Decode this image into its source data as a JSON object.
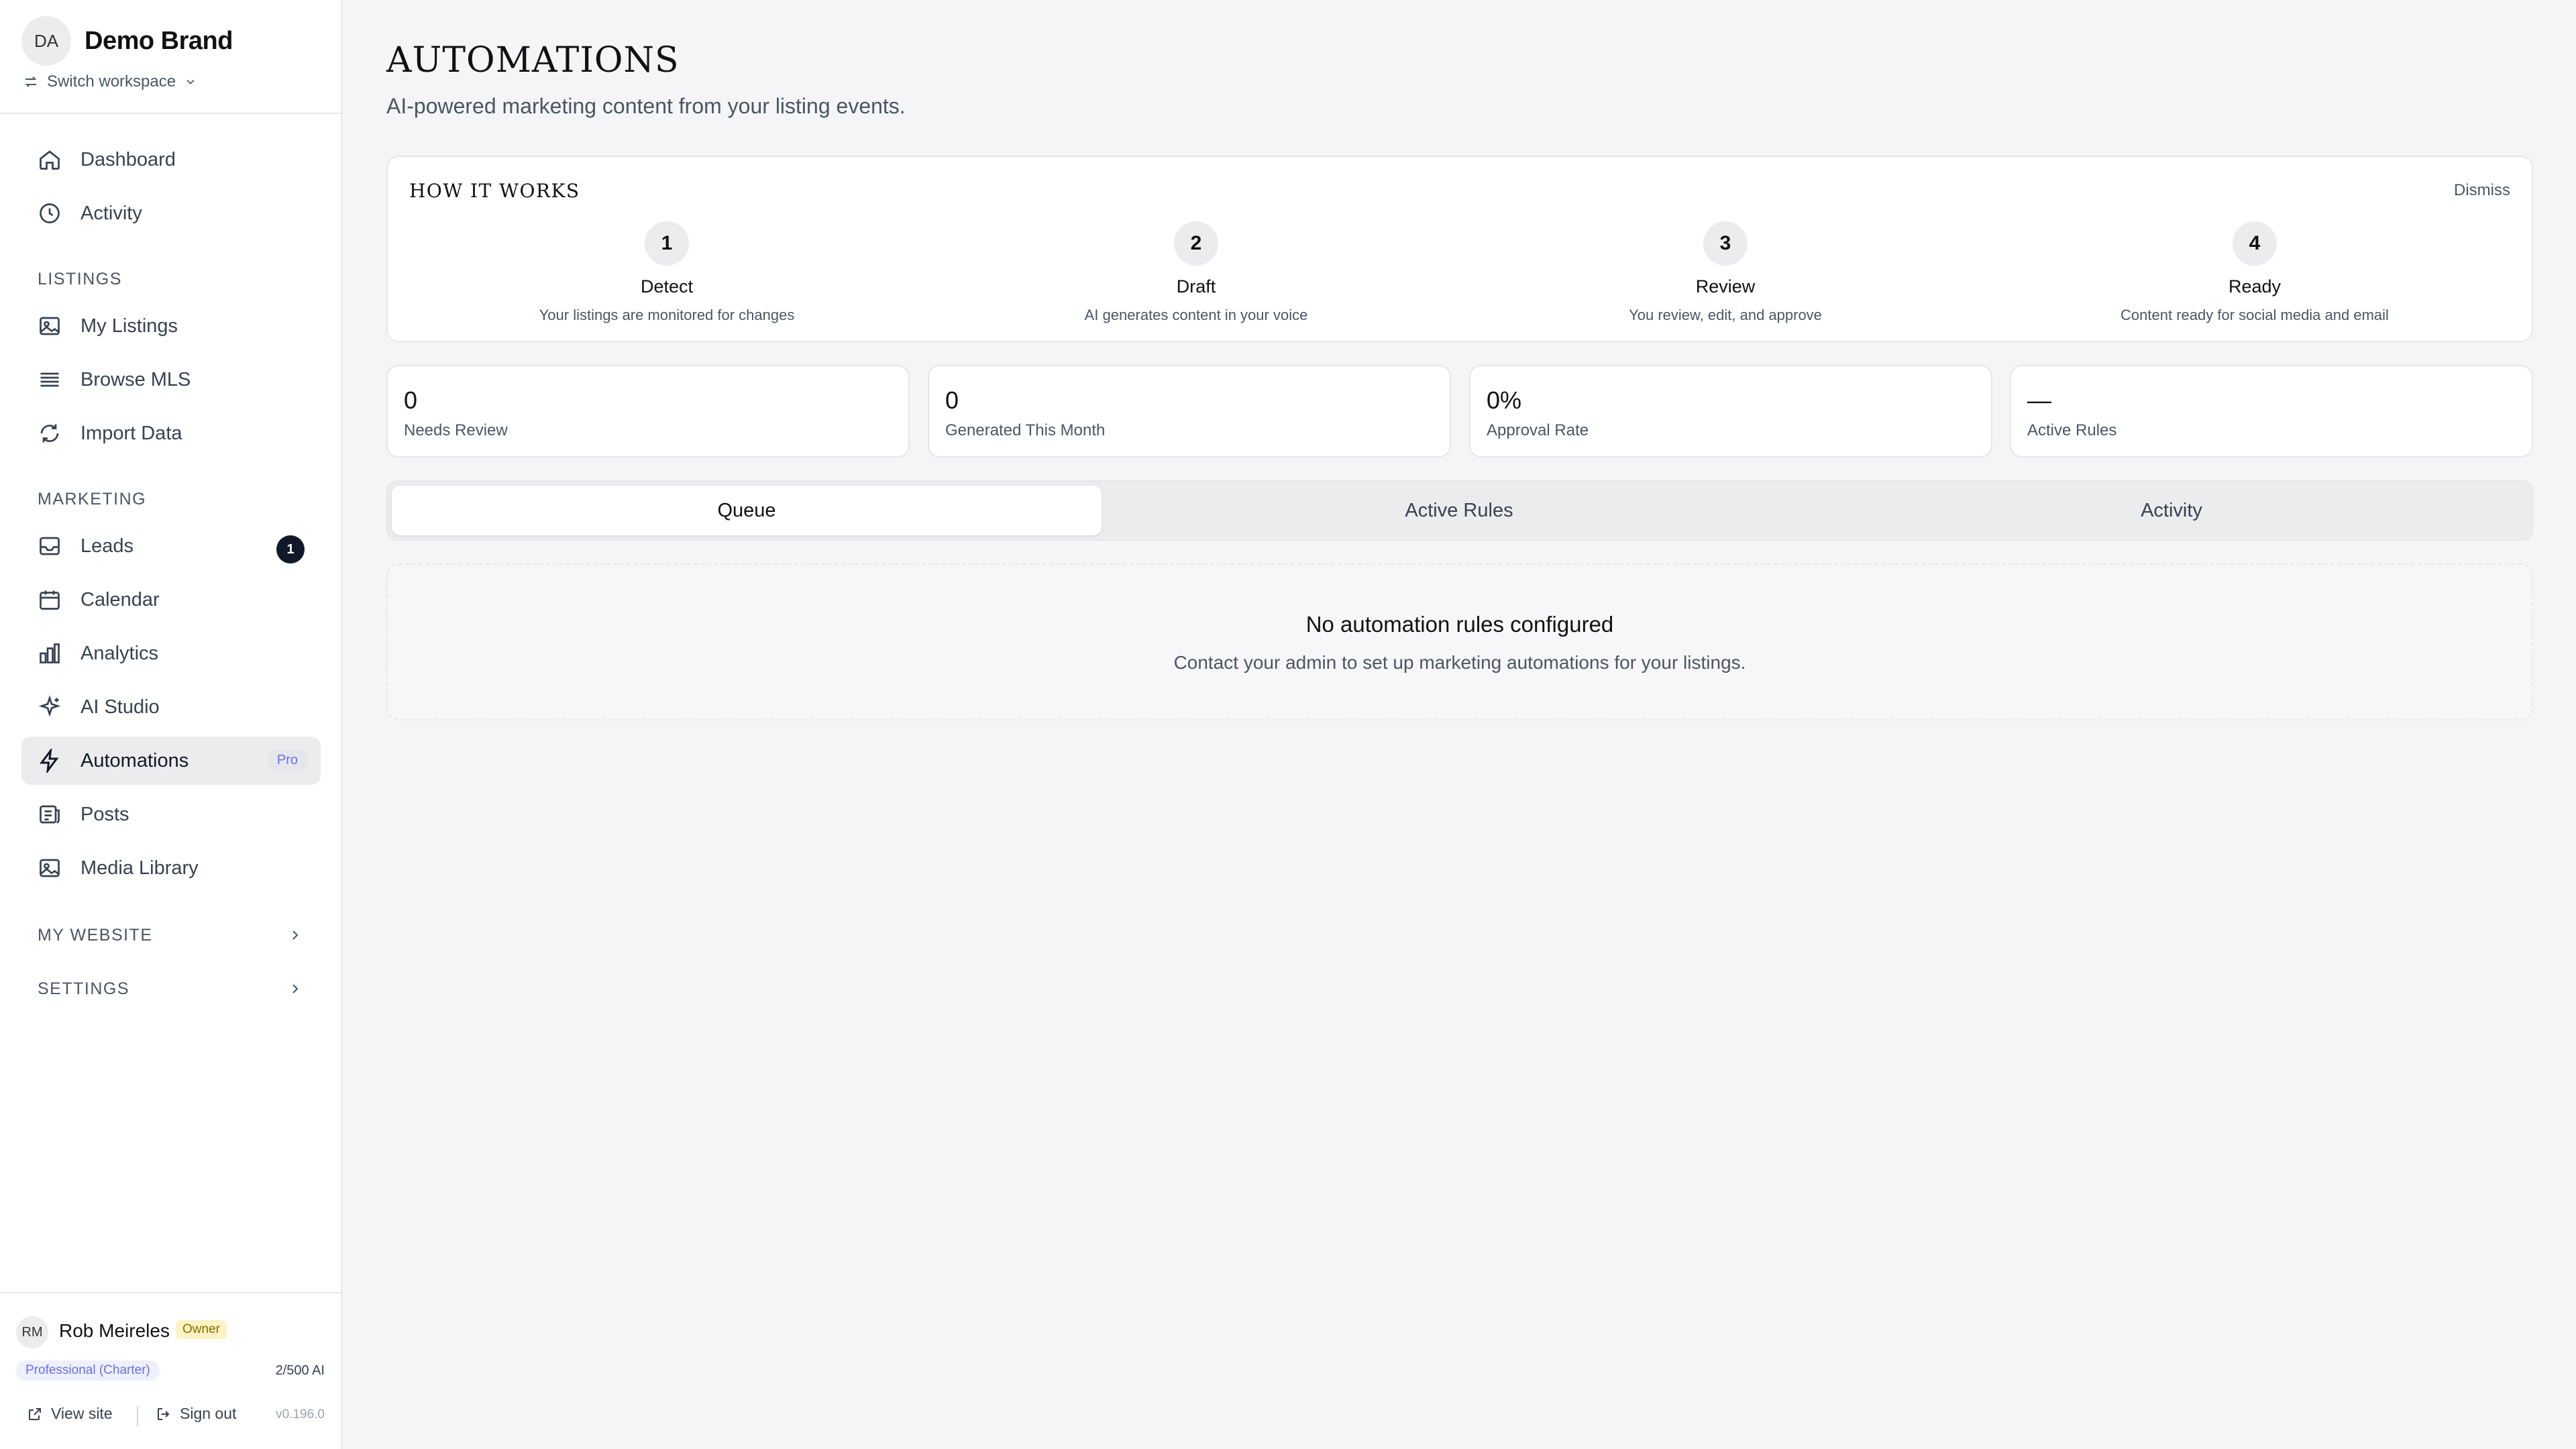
{
  "sidebar": {
    "brand": {
      "initials": "DA",
      "name": "Demo Brand"
    },
    "switch_workspace": "Switch workspace",
    "top_items": [
      {
        "label": "Dashboard",
        "icon": "home-icon"
      },
      {
        "label": "Activity",
        "icon": "clock-icon"
      }
    ],
    "listings": {
      "heading": "LISTINGS",
      "items": [
        {
          "label": "My Listings",
          "icon": "image-icon"
        },
        {
          "label": "Browse MLS",
          "icon": "list-icon"
        },
        {
          "label": "Import Data",
          "icon": "refresh-icon"
        }
      ]
    },
    "marketing": {
      "heading": "MARKETING",
      "items": [
        {
          "label": "Leads",
          "icon": "inbox-icon",
          "badge": "1"
        },
        {
          "label": "Calendar",
          "icon": "calendar-icon"
        },
        {
          "label": "Analytics",
          "icon": "bar-chart-icon"
        },
        {
          "label": "AI Studio",
          "icon": "sparkle-icon"
        },
        {
          "label": "Automations",
          "icon": "lightning-icon",
          "tag": "Pro",
          "active": true
        },
        {
          "label": "Posts",
          "icon": "newspaper-icon"
        },
        {
          "label": "Media Library",
          "icon": "image-icon"
        }
      ]
    },
    "my_website": "MY WEBSITE",
    "settings": "SETTINGS",
    "user": {
      "initials": "RM",
      "name": "Rob Meireles",
      "role": "Owner",
      "plan": "Professional (Charter)",
      "ai_usage": "2/500 AI",
      "view_site": "View site",
      "sign_out": "Sign out",
      "version": "v0.196.0"
    }
  },
  "main": {
    "title": "AUTOMATIONS",
    "subtitle": "AI-powered marketing content from your listing events.",
    "how_it_works": {
      "title": "HOW IT WORKS",
      "dismiss": "Dismiss",
      "steps": [
        {
          "num": "1",
          "title": "Detect",
          "desc": "Your listings are monitored for changes"
        },
        {
          "num": "2",
          "title": "Draft",
          "desc": "AI generates content in your voice"
        },
        {
          "num": "3",
          "title": "Review",
          "desc": "You review, edit, and approve"
        },
        {
          "num": "4",
          "title": "Ready",
          "desc": "Content ready for social media and email"
        }
      ]
    },
    "stats": [
      {
        "value": "0",
        "label": "Needs Review"
      },
      {
        "value": "0",
        "label": "Generated This Month"
      },
      {
        "value": "0%",
        "label": "Approval Rate"
      },
      {
        "value": "—",
        "label": "Active Rules"
      }
    ],
    "tabs": [
      {
        "label": "Queue",
        "active": true
      },
      {
        "label": "Active Rules"
      },
      {
        "label": "Activity"
      }
    ],
    "empty_state": {
      "title": "No automation rules configured",
      "desc": "Contact your admin to set up marketing automations for your listings."
    }
  },
  "colors": {
    "accent": "#111827",
    "pro_tag": "#6b6ef0",
    "owner_tag_bg": "#fdf3c4",
    "background": "#f5f5f7"
  }
}
